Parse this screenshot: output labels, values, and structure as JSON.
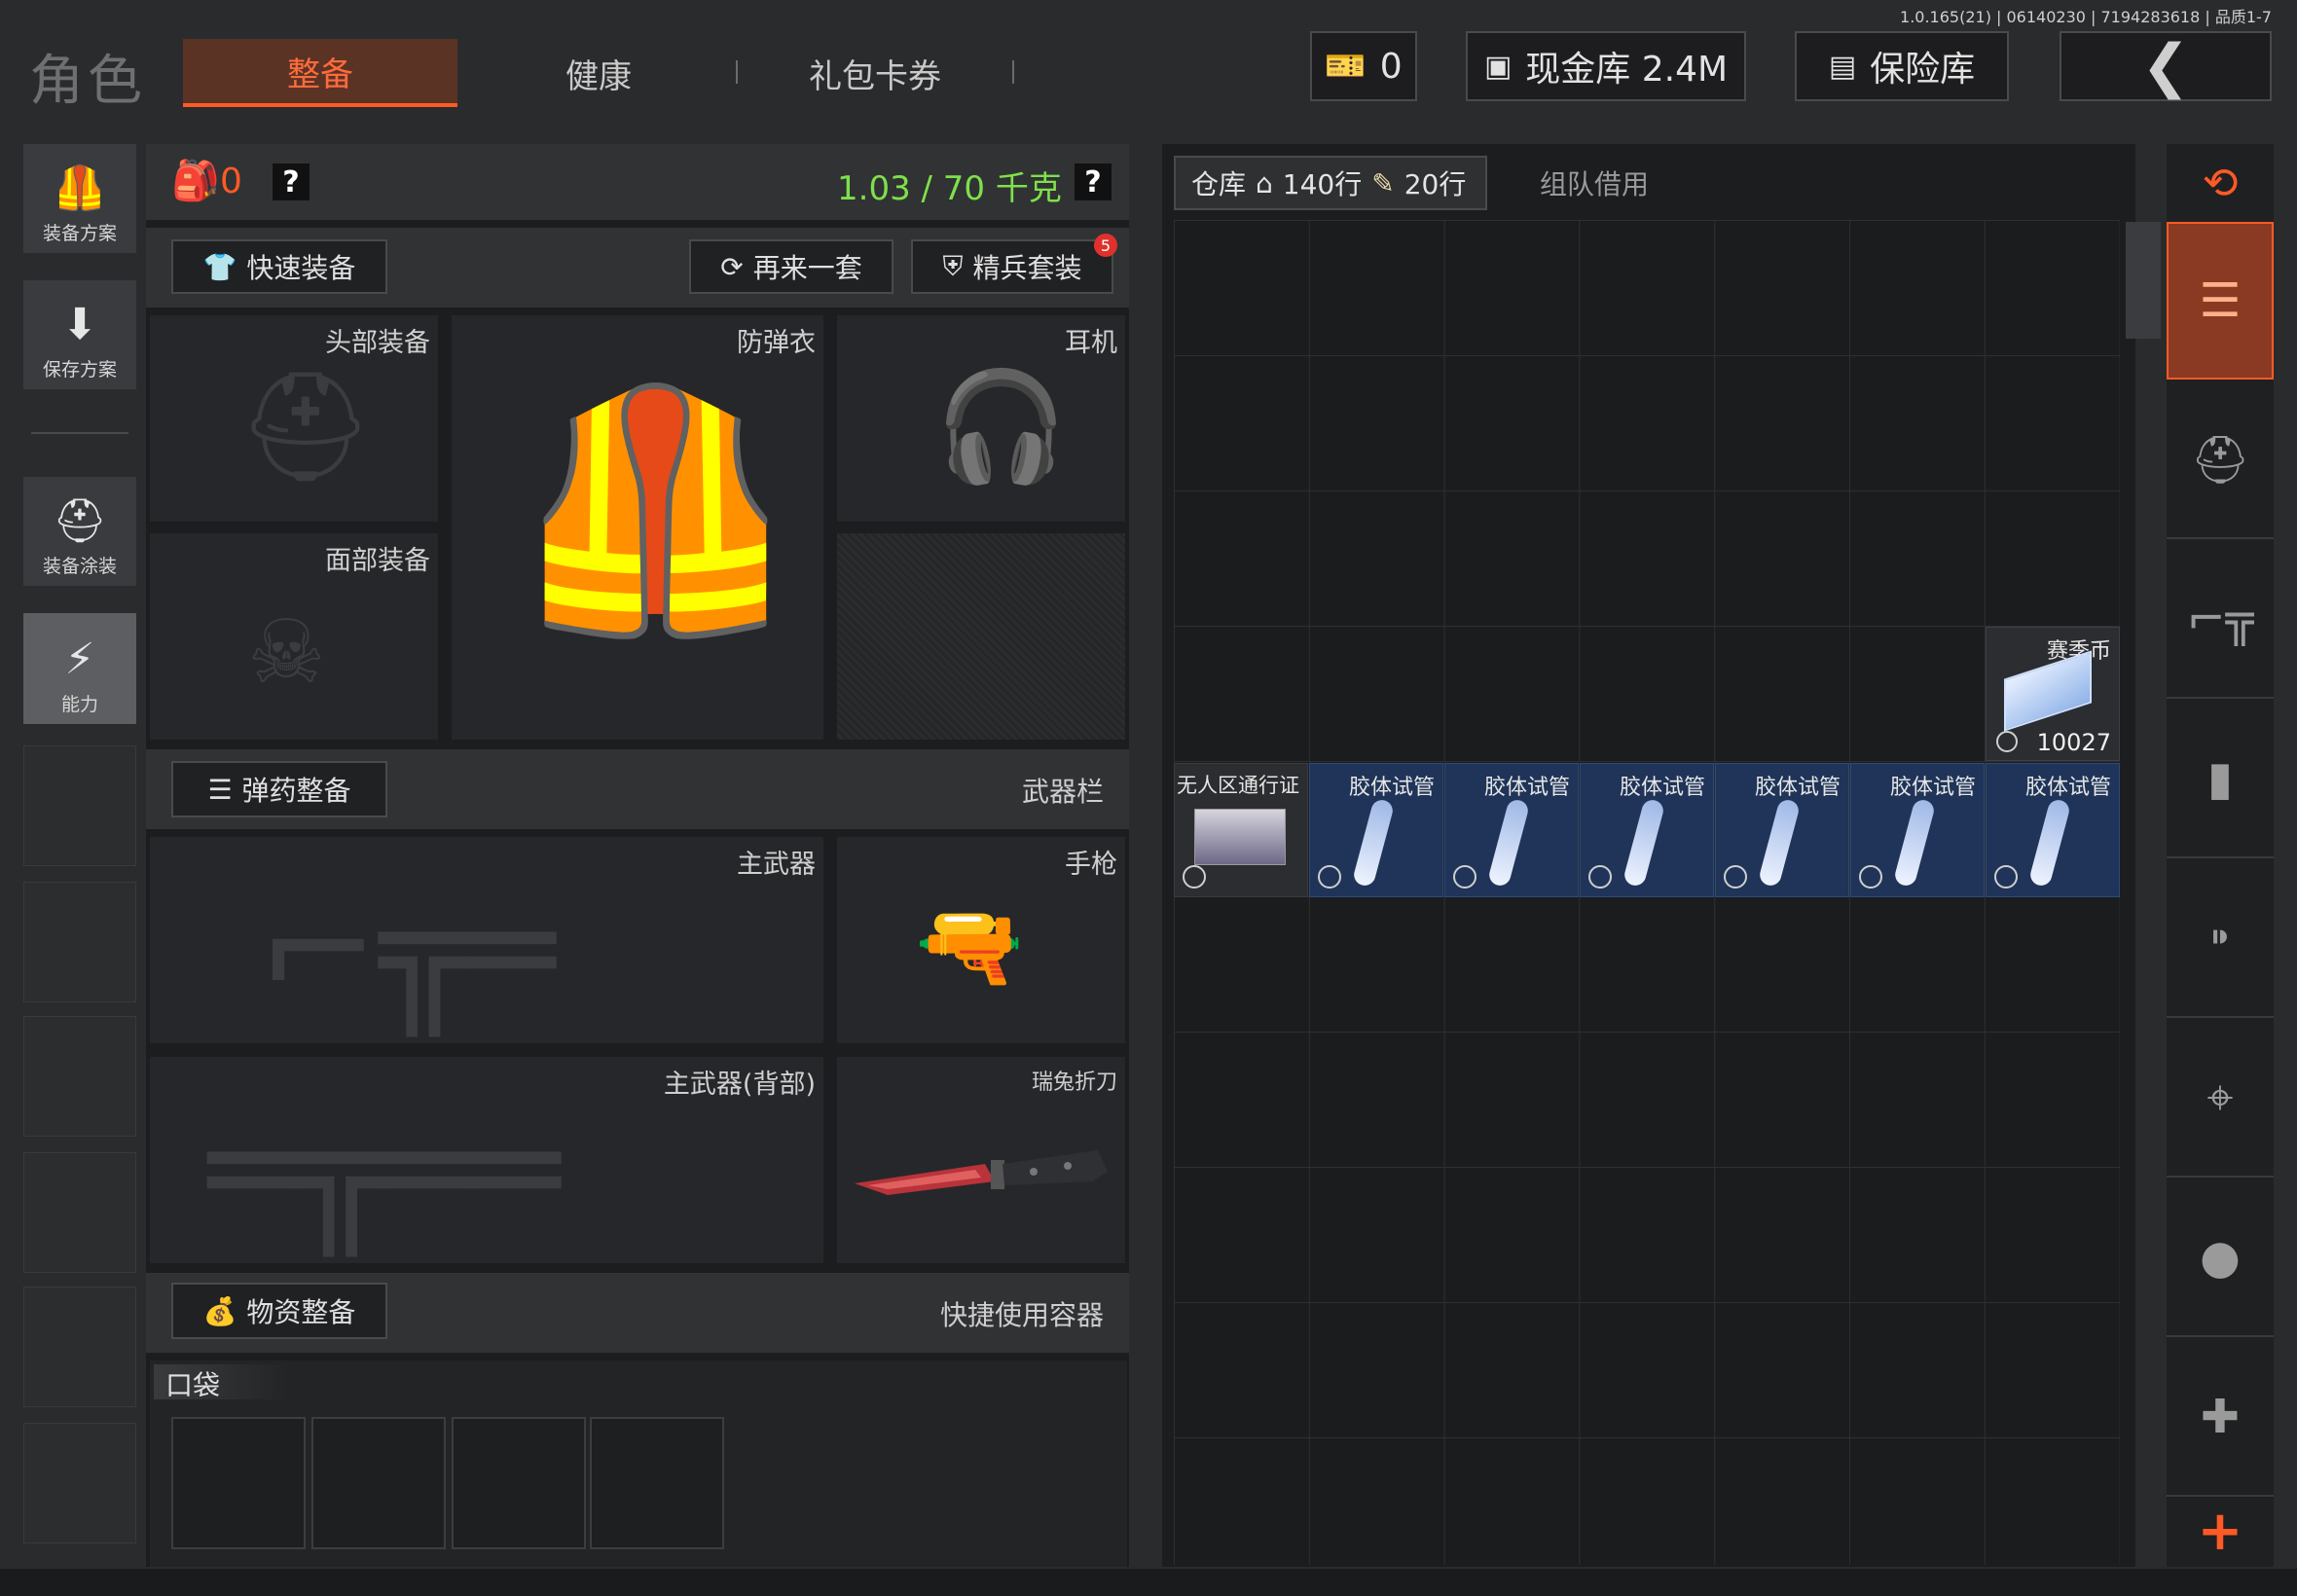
{
  "version_text": "1.0.165(21) | 06140230 | 7194283618 | 品质1-7",
  "app_title": "角色",
  "tabs": [
    {
      "label": "整备",
      "active": true
    },
    {
      "label": "健康",
      "active": false
    },
    {
      "label": "礼包卡券",
      "active": false
    }
  ],
  "topbar": {
    "currency_value": "0",
    "cash_vault_label": "现金库 2.4M",
    "safe_label": "保险库"
  },
  "left_rail": [
    {
      "label": "装备方案",
      "icon": "vest-icon"
    },
    {
      "label": "保存方案",
      "icon": "download-icon"
    },
    {
      "label": "装备涂装",
      "icon": "helmet-paint-icon"
    },
    {
      "label": "能力",
      "icon": "ability-icon"
    }
  ],
  "loadout": {
    "backpack_count": "0",
    "help_mark": "?",
    "weight": "1.03 / 70 千克",
    "quick_equip": "快速装备",
    "again_set": "再来一套",
    "elite_set": "精兵套装",
    "elite_badge": "5",
    "slots": {
      "head": "头部装备",
      "armor": "防弹衣",
      "headset": "耳机",
      "face": "面部装备",
      "primary": "主武器",
      "pistol": "手枪",
      "primary_back": "主武器(背部)",
      "knife": "瑞兔折刀"
    },
    "ammo_equip": "弹药整备",
    "weapon_bar": "武器栏",
    "supply_equip": "物资整备",
    "quick_container": "快捷使用容器",
    "pocket": "口袋"
  },
  "storage": {
    "warehouse_label": "仓库",
    "rows_home": "140行",
    "rows_ticket": "20行",
    "team_borrow": "组队借用",
    "season_coin": {
      "name": "赛季币",
      "count": "10027"
    },
    "items": [
      {
        "name": "无人区通行证",
        "highlight": false
      },
      {
        "name": "胶体试管",
        "highlight": true
      },
      {
        "name": "胶体试管",
        "highlight": true
      },
      {
        "name": "胶体试管",
        "highlight": true
      },
      {
        "name": "胶体试管",
        "highlight": true
      },
      {
        "name": "胶体试管",
        "highlight": true
      },
      {
        "name": "胶体试管",
        "highlight": true
      }
    ]
  },
  "right_rail": [
    "layers-refresh-icon",
    "layers-download-icon",
    "helmet-icon",
    "rifle-icon",
    "magazine-icon",
    "bullet-icon",
    "scope-icon",
    "grenade-icon",
    "medkit-icon",
    "plus-icon"
  ],
  "colors": {
    "accent": "#ff5a25",
    "weight_green": "#7ee04a",
    "item_blue": "#1f3458"
  }
}
